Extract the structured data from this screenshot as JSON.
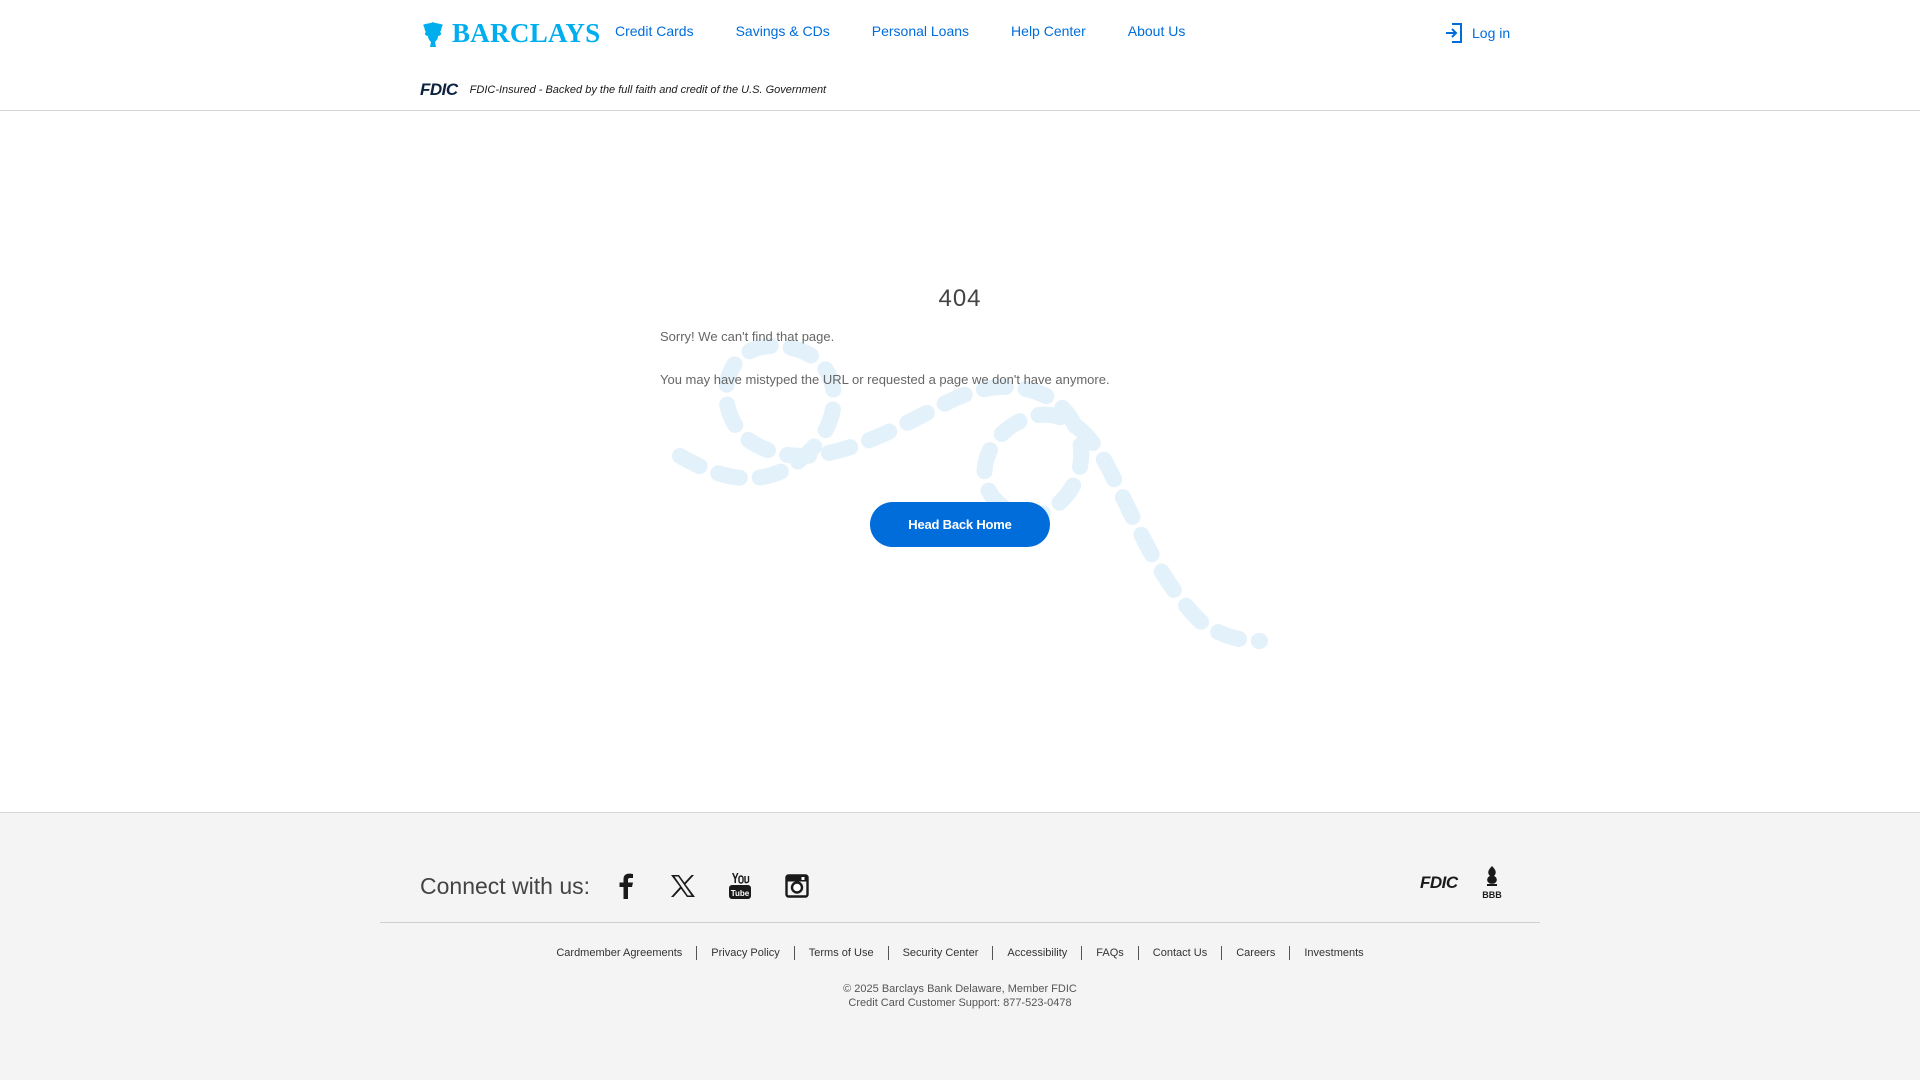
{
  "header": {
    "brand": "BARCLAYS",
    "nav": [
      "Credit Cards",
      "Savings & CDs",
      "Personal Loans",
      "Help Center",
      "About Us"
    ],
    "login_label": "Log in",
    "fdic_logo": "FDIC",
    "fdic_notice": "FDIC-Insured - Backed by the full faith and credit of the U.S. Government"
  },
  "main": {
    "error_code": "404",
    "message_1": "Sorry! We can't find that page.",
    "message_2": "You may have mistyped the URL or requested a page we don't have anymore.",
    "button_label": "Head Back Home"
  },
  "footer": {
    "connect_label": "Connect with us:",
    "social_icons": [
      "facebook-icon",
      "x-icon",
      "youtube-icon",
      "instagram-icon"
    ],
    "badge_fdic": "FDIC",
    "badge_bbb": "BBB",
    "links": [
      "Cardmember Agreements",
      "Privacy Policy",
      "Terms of Use",
      "Security Center",
      "Accessibility",
      "FAQs",
      "Contact Us",
      "Careers",
      "Investments"
    ],
    "copyright": "© 2025 Barclays Bank Delaware, Member FDIC",
    "support": "Credit Card Customer Support: 877-523-0478"
  },
  "colors": {
    "brand_blue": "#00aeef",
    "link_blue": "#006ddb",
    "footer_bg": "#f4f4f4",
    "swirl": "#e3f1fa"
  }
}
